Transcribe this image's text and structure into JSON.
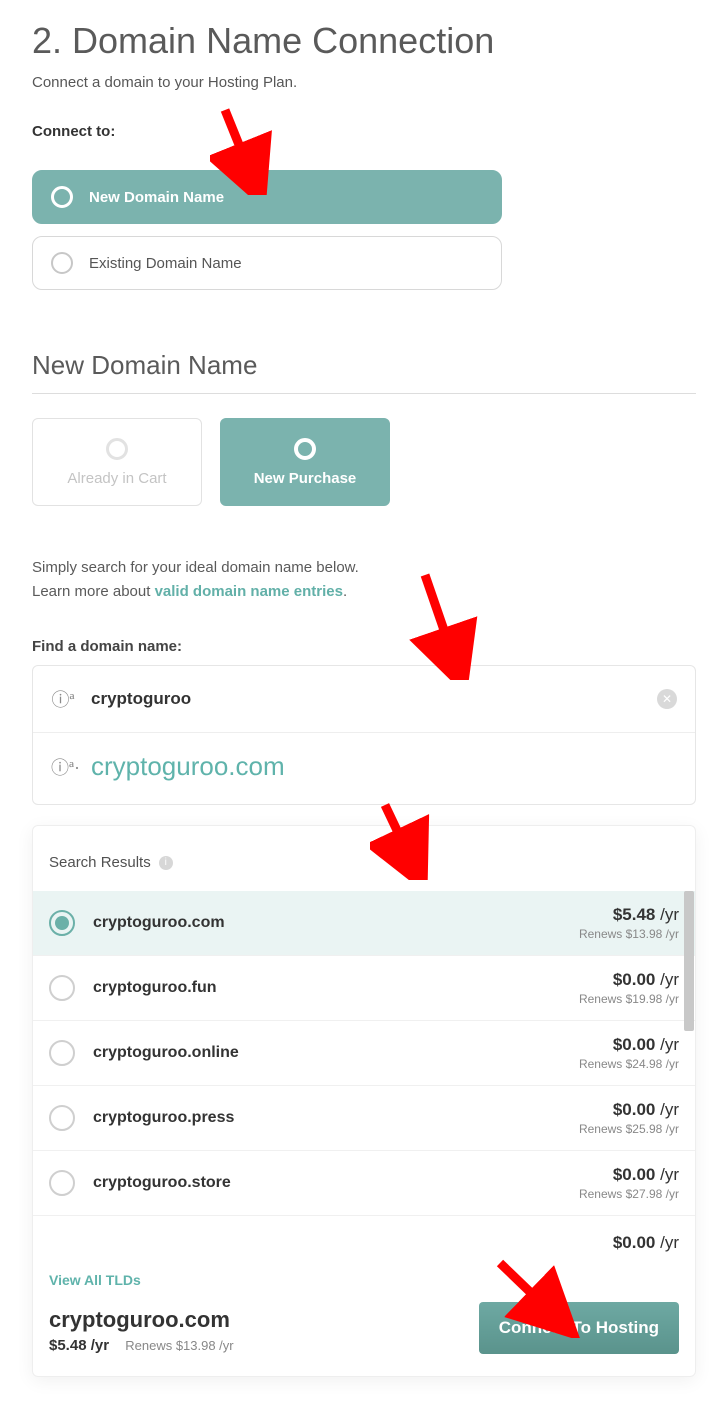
{
  "page_title": "2. Domain Name Connection",
  "page_subtitle": "Connect a domain to your Hosting Plan.",
  "connect_to_label": "Connect to:",
  "connect_options": [
    {
      "label": "New Domain Name",
      "selected": true
    },
    {
      "label": "Existing Domain Name",
      "selected": false
    }
  ],
  "section_title": "New Domain Name",
  "tabs": [
    {
      "label": "Already in Cart",
      "active": false
    },
    {
      "label": "New Purchase",
      "active": true
    }
  ],
  "helper_text_line1": "Simply search for your ideal domain name below.",
  "helper_text_line2a": "Learn more about ",
  "helper_link_text": "valid domain name entries",
  "helper_text_line2b": ".",
  "find_domain_label": "Find a domain name:",
  "search_query": "cryptoguroo",
  "search_suggestion": "cryptoguroo.com",
  "search_results_label": "Search Results",
  "results": [
    {
      "domain": "cryptoguroo.com",
      "price": "$5.48",
      "per": "/yr",
      "renews": "Renews $13.98 /yr",
      "selected": true
    },
    {
      "domain": "cryptoguroo.fun",
      "price": "$0.00",
      "per": "/yr",
      "renews": "Renews $19.98 /yr",
      "selected": false
    },
    {
      "domain": "cryptoguroo.online",
      "price": "$0.00",
      "per": "/yr",
      "renews": "Renews $24.98 /yr",
      "selected": false
    },
    {
      "domain": "cryptoguroo.press",
      "price": "$0.00",
      "per": "/yr",
      "renews": "Renews $25.98 /yr",
      "selected": false
    },
    {
      "domain": "cryptoguroo.store",
      "price": "$0.00",
      "per": "/yr",
      "renews": "Renews $27.98 /yr",
      "selected": false
    }
  ],
  "partial_next_price": "$0.00",
  "partial_next_per": "/yr",
  "view_all_label": "View All TLDs",
  "chosen_domain": "cryptoguroo.com",
  "chosen_price": "$5.48 /yr",
  "chosen_renews": "Renews $13.98 /yr",
  "connect_button": "Connect To Hosting"
}
